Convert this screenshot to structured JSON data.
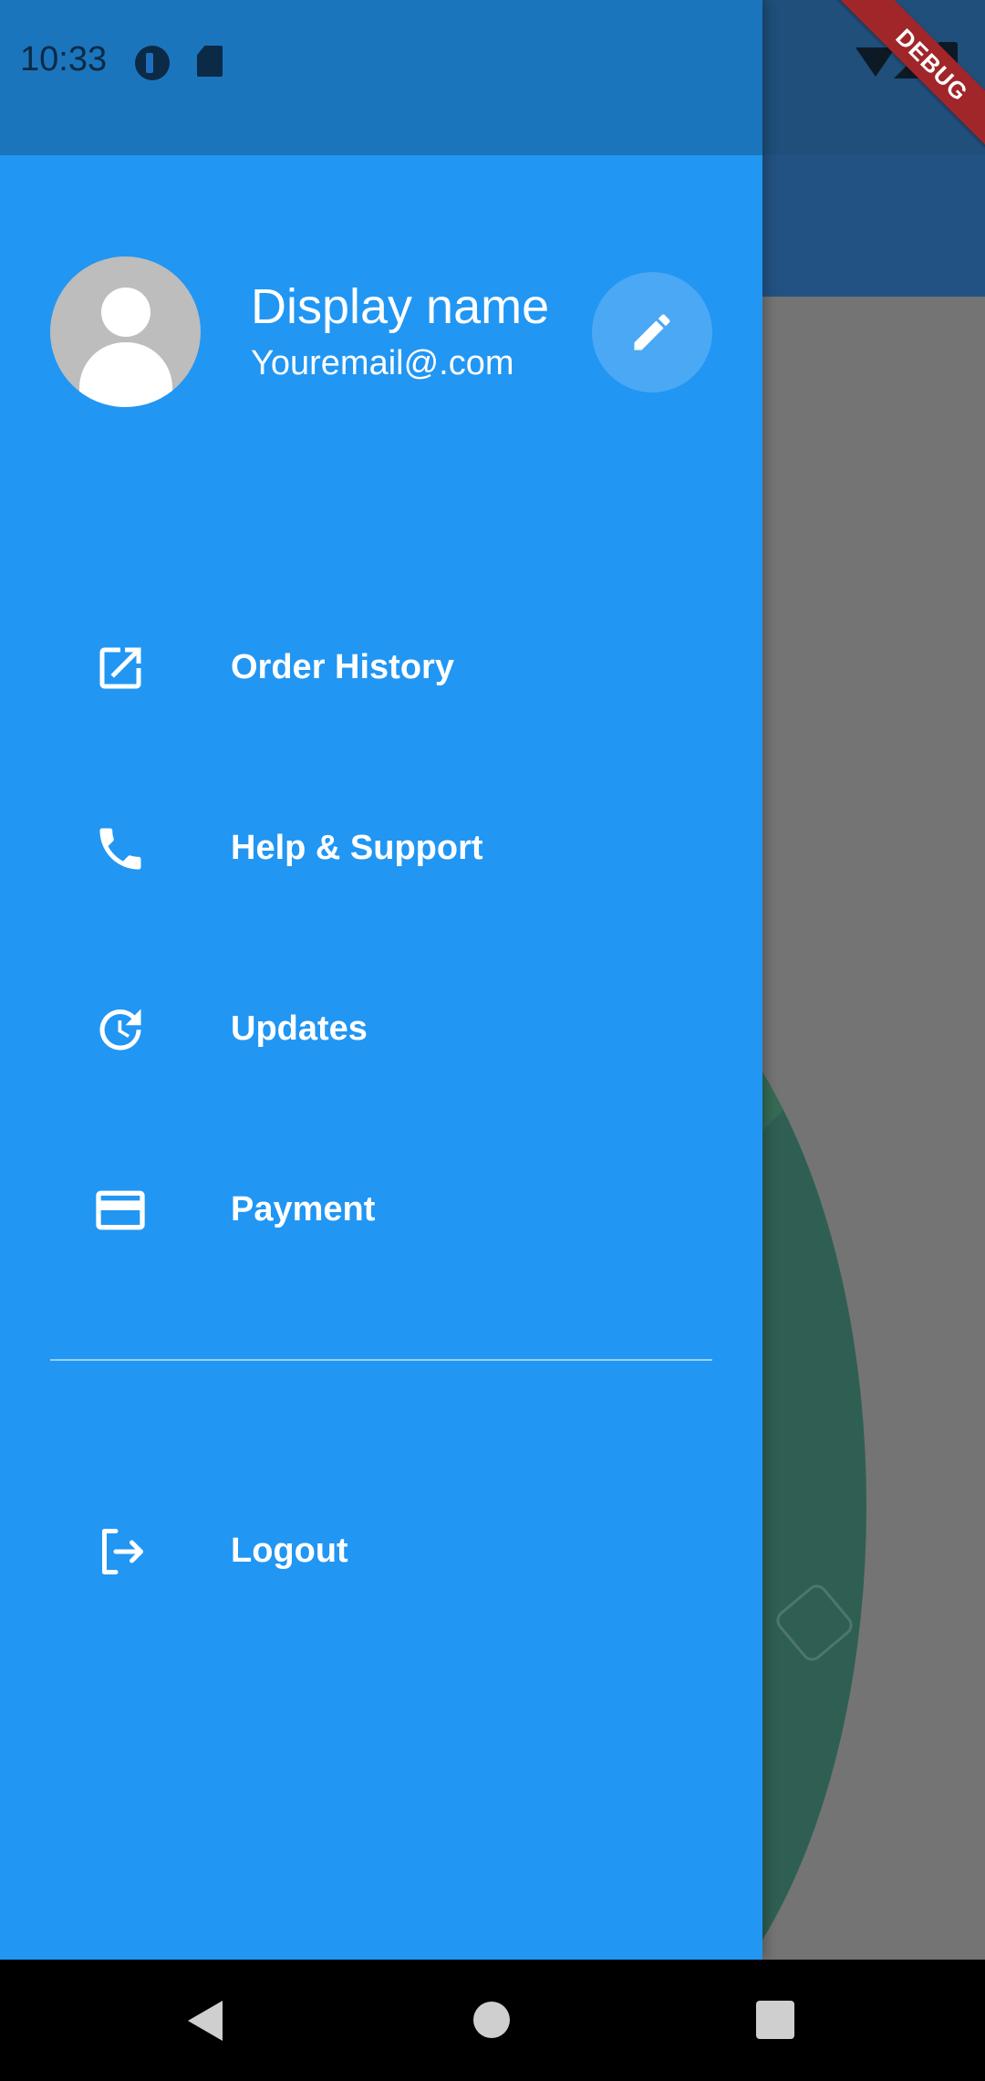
{
  "status_bar": {
    "time": "10:33",
    "icons": [
      "app-notification-icon",
      "sd-card-icon",
      "wifi-icon",
      "signal-icon",
      "battery-icon"
    ]
  },
  "debug_banner": {
    "label": "DEBUG"
  },
  "drawer": {
    "background_color": "#2196f3",
    "header": {
      "display_name": "Display name",
      "email": "Youremail@.com",
      "avatar_icon": "person-icon",
      "edit_icon": "pencil-icon"
    },
    "items": [
      {
        "label": "Order History",
        "icon": "open-in-new-icon"
      },
      {
        "label": "Help & Support",
        "icon": "phone-icon"
      },
      {
        "label": "Updates",
        "icon": "update-icon"
      },
      {
        "label": "Payment",
        "icon": "credit-card-icon"
      }
    ],
    "logout": {
      "label": "Logout",
      "icon": "logout-icon"
    }
  },
  "nav_bar": {
    "icons": [
      "back-icon",
      "home-icon",
      "recents-icon"
    ]
  }
}
